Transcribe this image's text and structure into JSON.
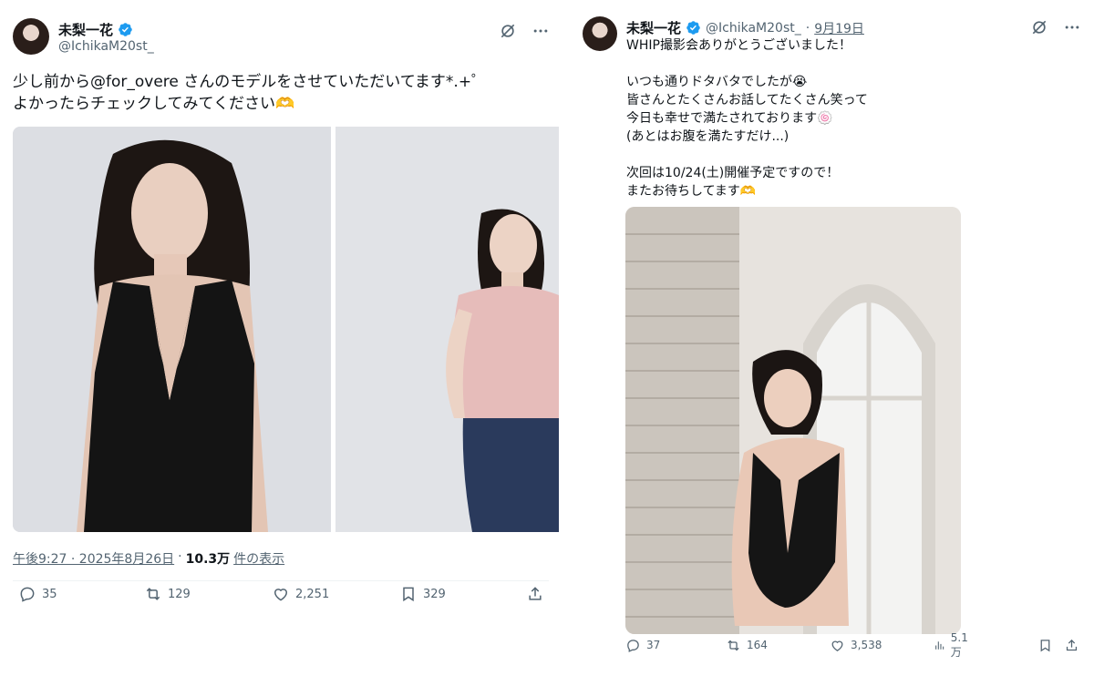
{
  "colors": {
    "verified": "#1d9bf0",
    "text": "#0f1419",
    "secondary": "#536471",
    "divider": "#eff3f4"
  },
  "left_tweet": {
    "display_name": "未梨一花",
    "handle": "@IchikaM20st_",
    "text_lines": [
      "少し前から@for_overe さんのモデルをさせていただいてます*.+゜",
      "よかったらチェックしてみてください🫶"
    ],
    "time": "午後9:27 · 2025年8月26日",
    "separator": "·",
    "views_count": "10.3万",
    "views_label": "件の表示",
    "stats": {
      "replies": "35",
      "retweets": "129",
      "likes": "2,251",
      "bookmarks": "329"
    },
    "icons": [
      "grok-icon",
      "more-icon",
      "verified-icon",
      "reply-icon",
      "retweet-icon",
      "like-icon",
      "bookmark-icon",
      "share-icon"
    ]
  },
  "right_tweet": {
    "display_name": "未梨一花",
    "handle": "@IchikaM20st_",
    "dot": "·",
    "date": "9月19日",
    "text_lines": [
      "WHIP撮影会ありがとうございました！",
      "",
      "いつも通りドタバタでしたが😭",
      "皆さんとたくさんお話してたくさん笑って",
      "今日も幸せで満たされております🍥",
      "(あとはお腹を満たすだけ...)",
      "",
      "次回は10/24(土)開催予定ですので！",
      "またお待ちしてます🫶"
    ],
    "stats": {
      "replies": "37",
      "retweets": "164",
      "likes": "3,538",
      "views": "5.1万"
    },
    "icons": [
      "grok-icon",
      "more-icon",
      "verified-icon",
      "reply-icon",
      "retweet-icon",
      "like-icon",
      "views-icon",
      "bookmark-icon",
      "share-icon"
    ]
  }
}
